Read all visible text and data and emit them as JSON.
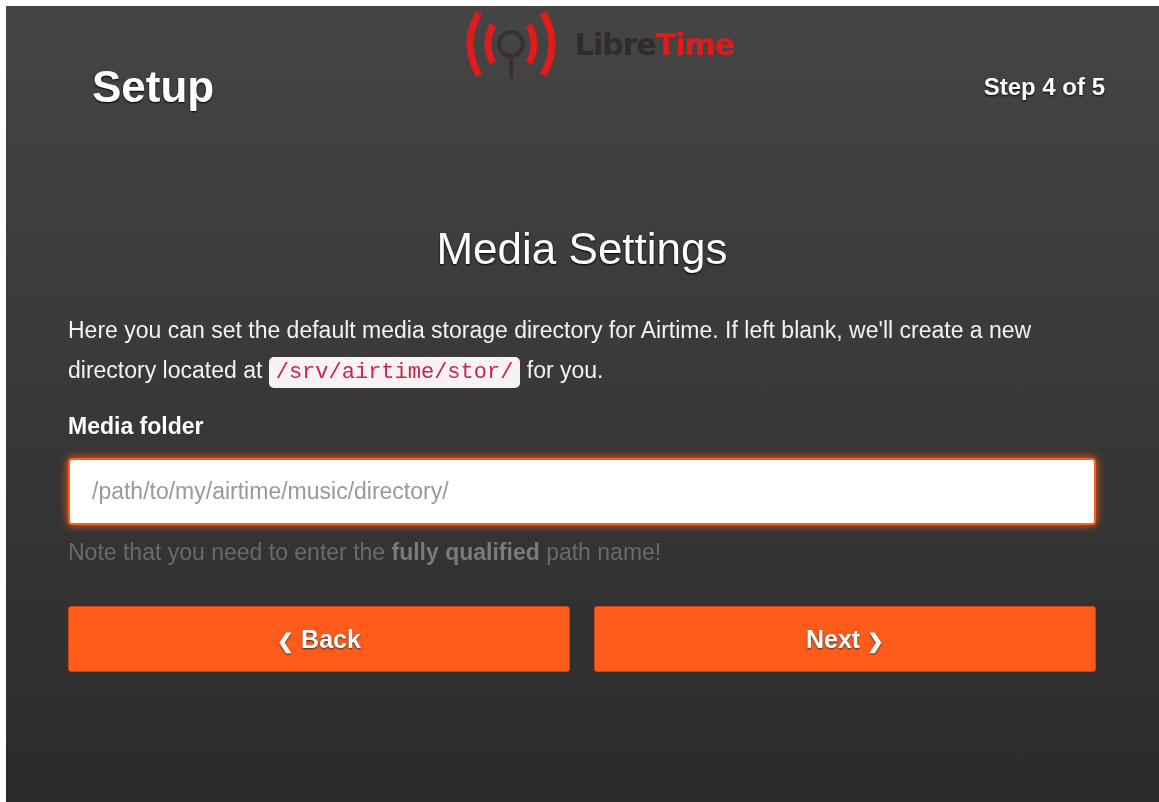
{
  "logo": {
    "wordmark": [
      "Libre",
      "Time"
    ]
  },
  "header": {
    "title": "Setup",
    "step": "Step 4 of 5"
  },
  "heading": "Media Settings",
  "intro": {
    "before": "Here you can set the default media storage directory for Airtime. If left blank, we'll create a new directory located at",
    "code": "/srv/airtime/stor/",
    "after": "for you."
  },
  "field": {
    "label": "Media folder",
    "placeholder": "/path/to/my/airtime/music/directory/",
    "focused": true
  },
  "note": "Note that you need to enter the **fully qualified** path name!",
  "buttons": [
    {
      "label": "Back",
      "icon": "❮",
      "kind": "back"
    },
    {
      "label": "Next",
      "icon": "❯",
      "kind": "next"
    }
  ]
}
